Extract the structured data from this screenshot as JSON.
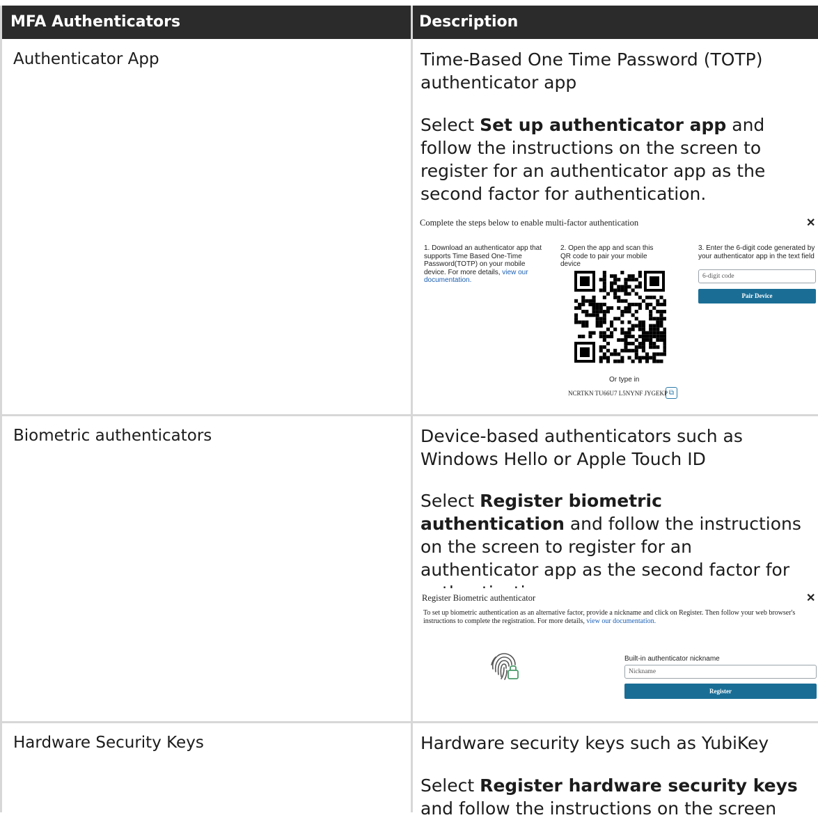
{
  "table": {
    "headers": [
      "MFA Authenticators",
      "Description"
    ],
    "rows": [
      {
        "name": "Authenticator App",
        "desc1": "Time-Based One Time Password (TOTP) authenticator app",
        "select_word": "Select",
        "select_bold": "Set up authenticator app",
        "select_rest": "and follow the instructions on the screen to register for an authenticator app as the second factor for authentication."
      },
      {
        "name": "Biometric authenticators",
        "desc1": "Device-based authenticators such as Windows Hello or Apple Touch ID",
        "select_word": "Select",
        "select_bold": "Register biometric authentication",
        "select_rest": "and follow the instructions on the screen to register for an authenticator app as the second factor for authentication."
      },
      {
        "name": "Hardware Security Keys",
        "desc1": "Hardware security keys such as YubiKey",
        "select_word": "Select",
        "select_bold": "Register hardware security keys",
        "select_rest": "and follow the instructions on the screen"
      }
    ]
  },
  "mfa_dialog": {
    "title": "Complete the steps below to enable multi-factor authentication",
    "close": "✕",
    "step1_text": "1. Download an authenticator app that supports Time Based One-Time Password(TOTP) on your mobile device. For more details,",
    "step1_link": "view our documentation.",
    "step2_text": "2. Open the app and scan this QR code to pair your mobile device",
    "type_in_label": "Or type in",
    "secret_code": "NCRTKN TU66U7 L5NYNF JYGEKP",
    "step3_text": "3. Enter the 6-digit code generated by your authenticator app in the text field",
    "code_placeholder": "6-digit code",
    "pair_button": "Pair Device"
  },
  "bio_dialog": {
    "title": "Register Biometric authenticator",
    "close": "✕",
    "info_text": "To set up biometric authentication as an alternative factor, provide a nickname and click on Register. Then follow your web browser's instructions to complete the registration. For more details,",
    "info_link": "view our documentation.",
    "nickname_label": "Built-in authenticator nickname",
    "nickname_placeholder": "Nickname",
    "register_button": "Register"
  }
}
